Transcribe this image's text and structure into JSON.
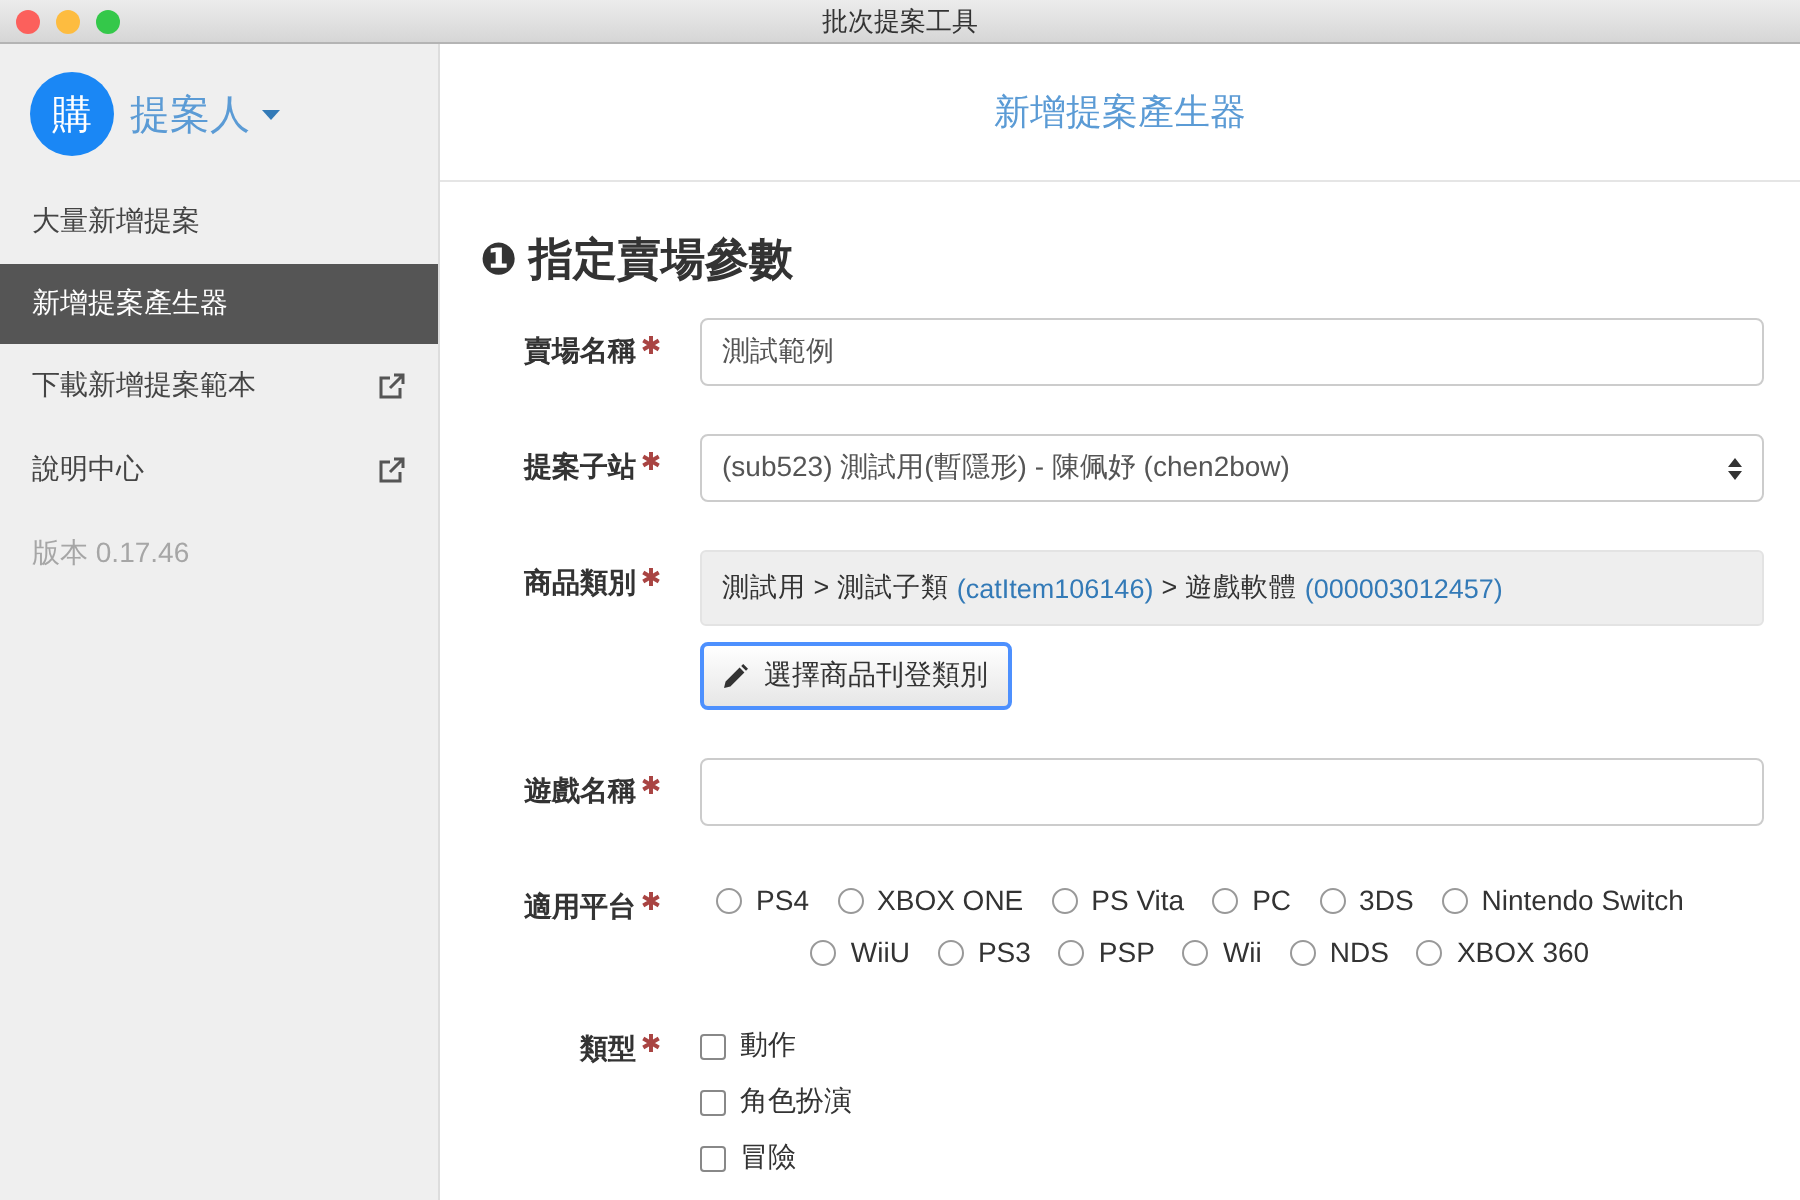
{
  "window": {
    "title": "批次提案工具"
  },
  "sidebar": {
    "user": {
      "avatar": "購",
      "name": "提案人"
    },
    "items": [
      {
        "label": "大量新增提案",
        "selected": false,
        "external": false
      },
      {
        "label": "新增提案產生器",
        "selected": true,
        "external": false
      },
      {
        "label": "下載新增提案範本",
        "selected": false,
        "external": true
      },
      {
        "label": "說明中心",
        "selected": false,
        "external": true
      }
    ],
    "version": "版本 0.17.46"
  },
  "header": {
    "title": "新增提案產生器"
  },
  "section": {
    "number": "❶",
    "title": "指定賣場參數"
  },
  "fields": [
    {
      "kind": "text",
      "label": "賣場名稱",
      "required": true,
      "value": "測試範例"
    },
    {
      "kind": "select",
      "label": "提案子站",
      "required": true,
      "value": "(sub523) 測試用(暫隱形) - 陳佩妤 (chen2bow)"
    },
    {
      "kind": "category",
      "label": "商品類別",
      "required": true,
      "path": [
        {
          "kind": "plain",
          "text": "測試用 > 測試子類"
        },
        {
          "kind": "code",
          "text": "(catItem106146)"
        },
        {
          "kind": "plain",
          "text": "> 遊戲軟體"
        },
        {
          "kind": "code",
          "text": "(000003012457)"
        }
      ],
      "button": "選擇商品刊登類別"
    },
    {
      "kind": "text",
      "label": "遊戲名稱",
      "required": true
    },
    {
      "kind": "radio",
      "label": "適用平台",
      "required": true,
      "options": [
        {
          "label": "PS4",
          "selected": false
        },
        {
          "label": "XBOX ONE",
          "selected": false
        },
        {
          "label": "PS Vita",
          "selected": false
        },
        {
          "label": "PC",
          "selected": false
        },
        {
          "label": "3DS",
          "selected": false
        },
        {
          "label": "Nintendo Switch",
          "selected": false
        },
        {
          "label": "WiiU",
          "selected": false
        },
        {
          "label": "PS3",
          "selected": false
        },
        {
          "label": "PSP",
          "selected": false
        },
        {
          "label": "Wii",
          "selected": false
        },
        {
          "label": "NDS",
          "selected": false
        },
        {
          "label": "XBOX 360",
          "selected": false
        }
      ]
    },
    {
      "kind": "checkbox",
      "label": "類型",
      "required": true,
      "options": [
        {
          "label": "動作",
          "checked": false
        },
        {
          "label": "角色扮演",
          "checked": false
        },
        {
          "label": "冒險",
          "checked": false
        }
      ]
    }
  ]
}
